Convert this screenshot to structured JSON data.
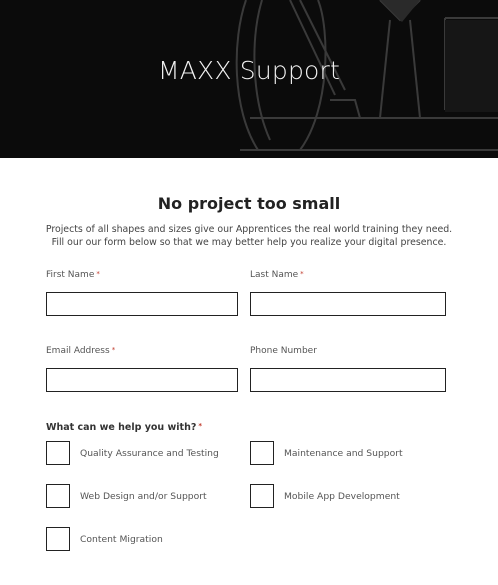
{
  "header": {
    "title": "MAXX Support"
  },
  "main": {
    "heading": "No project too small",
    "intro": "Projects of all shapes and sizes give our Apprentices the real world training they need. Fill our our form below so that we may better help you realize your digital presence."
  },
  "form": {
    "required_marker": "*",
    "first_name": {
      "label": "First Name",
      "value": ""
    },
    "last_name": {
      "label": "Last Name",
      "value": ""
    },
    "email": {
      "label": "Email Address",
      "value": ""
    },
    "phone": {
      "label": "Phone Number",
      "value": ""
    },
    "help_question": "What can we help you with?",
    "options": [
      {
        "label": "Quality Assurance and Testing",
        "checked": false
      },
      {
        "label": "Maintenance and Support",
        "checked": false
      },
      {
        "label": "Web Design and/or Support",
        "checked": false
      },
      {
        "label": "Mobile App Development",
        "checked": false
      },
      {
        "label": "Content Migration",
        "checked": false
      }
    ]
  },
  "colors": {
    "hero_background": "#0b0b0b",
    "hero_text": "#f2f2f2",
    "field_border": "#222222",
    "required_marker": "#c0392b"
  }
}
